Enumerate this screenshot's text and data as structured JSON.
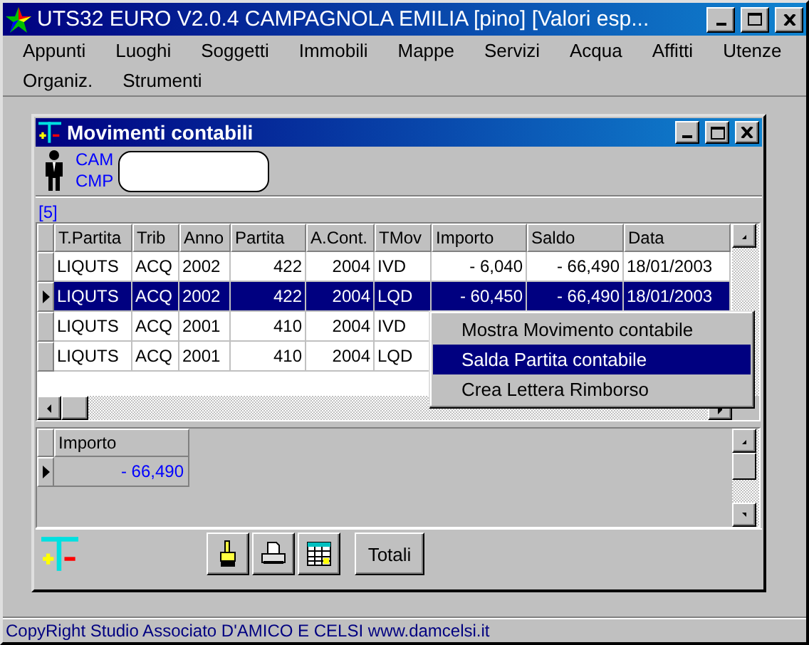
{
  "window": {
    "title": "UTS32 EURO V2.0.4 CAMPAGNOLA EMILIA [pino]  [Valori esp..."
  },
  "menu_rows": [
    [
      "Appunti",
      "Luoghi",
      "Soggetti",
      "Immobili",
      "Mappe",
      "Servizi",
      "Acqua",
      "Affitti",
      "Utenze"
    ],
    [
      "Organiz.",
      "Strumenti"
    ]
  ],
  "child_window": {
    "title": "Movimenti contabili",
    "subject_lines": [
      "CAM",
      "CMP"
    ],
    "record_count": "[5]",
    "grid": {
      "columns": [
        "T.Partita",
        "Trib",
        "Anno",
        "Partita",
        "A.Cont.",
        "TMov",
        "Importo",
        "Saldo",
        "Data"
      ],
      "rows": [
        {
          "selected": false,
          "cells": [
            "LIQUTS",
            "ACQ",
            "2002",
            "422",
            "2004",
            "IVD",
            "- 6,040",
            "- 66,490",
            "18/01/2003"
          ]
        },
        {
          "selected": true,
          "cells": [
            "LIQUTS",
            "ACQ",
            "2002",
            "422",
            "2004",
            "LQD",
            "- 60,450",
            "- 66,490",
            "18/01/2003"
          ]
        },
        {
          "selected": false,
          "cells": [
            "LIQUTS",
            "ACQ",
            "2001",
            "410",
            "2004",
            "IVD"
          ]
        },
        {
          "selected": false,
          "cells": [
            "LIQUTS",
            "ACQ",
            "2001",
            "410",
            "2004",
            "LQD"
          ]
        }
      ]
    },
    "context_menu": {
      "items": [
        {
          "label": "Mostra Movimento contabile",
          "selected": false
        },
        {
          "label": "Salda Partita contabile",
          "selected": true
        },
        {
          "label": "Crea Lettera Rimborso",
          "selected": false
        }
      ]
    },
    "totals_grid": {
      "columns": [
        "Importo"
      ],
      "rows": [
        {
          "selected": true,
          "cells": [
            "- 66,490"
          ]
        }
      ]
    },
    "toolbar": [
      {
        "kind": "hand"
      },
      {
        "kind": "print"
      },
      {
        "kind": "table"
      },
      {
        "kind": "text",
        "label": "Totali"
      }
    ]
  },
  "status_bar": "CopyRight Studio Associato D'AMICO E CELSI www.damcelsi.it"
}
